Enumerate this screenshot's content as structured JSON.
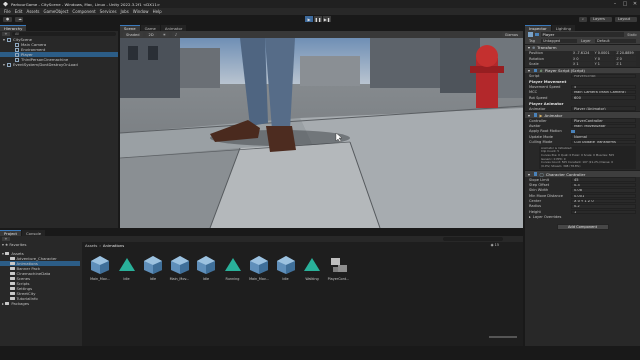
{
  "window": {
    "title": "ParkourGame - CityScene - Windows, Mac, Linux - Unity 2022.3.2f1 <DX11>",
    "controls": [
      "–",
      "□",
      "✕"
    ]
  },
  "menu": [
    "File",
    "Edit",
    "Assets",
    "GameObject",
    "Component",
    "Services",
    "Jobs",
    "Window",
    "Help"
  ],
  "toolbar": {
    "account": "●",
    "layers": "Layers",
    "layout": "Layout",
    "play_buttons": [
      "▶",
      "❚❚",
      "▶❚"
    ]
  },
  "hierarchy": {
    "tab": "Hierarchy",
    "search_placeholder": "All",
    "rows": [
      {
        "label": "CityScene",
        "indent": 0,
        "selected": false
      },
      {
        "label": "Main Camera",
        "indent": 1,
        "selected": false
      },
      {
        "label": "Environment",
        "indent": 1,
        "selected": false
      },
      {
        "label": "Player",
        "indent": 1,
        "selected": true
      },
      {
        "label": "ThirdPersonCinemachine",
        "indent": 1,
        "selected": false
      },
      {
        "label": "EventSystem/DontDestroyOnLoad",
        "indent": 0,
        "selected": false
      }
    ]
  },
  "center_tabs": [
    "Scene",
    "Game",
    "Animator"
  ],
  "scene_toolbar": {
    "shading": "Shaded",
    "mode": "2D",
    "gizmos": "Gizmos"
  },
  "project": {
    "tabs": [
      "Project",
      "Console"
    ],
    "breadcrumb": [
      "Assets",
      "Animations"
    ],
    "favorites_label": "Favorites",
    "assets_label": "Assets",
    "packages_label": "Packages",
    "folders": [
      "Adventure_Character",
      "Animations",
      "Banner Pack",
      "CinemachineData",
      "Scenes",
      "Scripts",
      "Settings",
      "StreetCity",
      "TutorialInfo"
    ],
    "items": [
      {
        "name": "Main_Mov...",
        "kind": "model"
      },
      {
        "name": "Idle",
        "kind": "clip"
      },
      {
        "name": "Idle",
        "kind": "model"
      },
      {
        "name": "Main_Mov...",
        "kind": "model"
      },
      {
        "name": "Idle",
        "kind": "model"
      },
      {
        "name": "Running",
        "kind": "clip"
      },
      {
        "name": "Main_Mov...",
        "kind": "model"
      },
      {
        "name": "Idle",
        "kind": "model"
      },
      {
        "name": "Walking",
        "kind": "clip"
      },
      {
        "name": "PlayerCont...",
        "kind": "controller"
      }
    ],
    "item_count": "15"
  },
  "inspector": {
    "tabs": [
      "Inspector",
      "Lighting"
    ],
    "object_name": "Player",
    "static_label": "Static",
    "tag_label": "Tag",
    "tag_value": "Untagged",
    "layer_label": "Layer",
    "layer_value": "Default",
    "transform": {
      "title": "Transform",
      "position_label": "Position",
      "position": [
        "-7.6124",
        "0.0001",
        "20.8859"
      ],
      "rotation_label": "Rotation",
      "rotation": [
        "0",
        "0",
        "0"
      ],
      "scale_label": "Scale",
      "scale": [
        "1",
        "1",
        "1"
      ]
    },
    "player_script": {
      "title": "Player Script (Script)",
      "script_label": "Script",
      "script_value": "PlayerScript",
      "movement_title": "Player Movement",
      "movement_speed_label": "Movement Speed",
      "movement_speed": "5",
      "mcc_label": "MCC",
      "mcc_value": "Main Camera (Main Camera)",
      "rot_speed_label": "Rot Speed",
      "rot_speed": "600",
      "anim_title": "Player Animator",
      "animator_label": "Animator",
      "animator_value": "Player (Animator)"
    },
    "animator": {
      "title": "Animator",
      "controller_label": "Controller",
      "controller_value": "PlayerController",
      "avatar_label": "Avatar",
      "avatar_value": "Main_MoveAvatar",
      "root_motion_label": "Apply Root Motion",
      "update_mode_label": "Update Mode",
      "update_mode_value": "Normal",
      "culling_mode_label": "Culling Mode",
      "culling_mode_value": "Cull Update Transforms",
      "info_lines": [
        "Animator is Initialized",
        "Clip Count: 5",
        "Curves Pos: 0 Quat: 0 Euler: 0 Scale: 0 Muscles: 505",
        "Generic: 0 PPtr: 0",
        "Curves Count: 505 Constant: 107 (21.2%) Dense: 0",
        "(0.0%) Stream: 398 (78.8%)"
      ]
    },
    "character_controller": {
      "title": "Character Controller",
      "rows": [
        {
          "label": "Slope Limit",
          "value": "45"
        },
        {
          "label": "Step Offset",
          "value": "0.3"
        },
        {
          "label": "Skin Width",
          "value": "0.08"
        },
        {
          "label": "Min Move Distance",
          "value": "0.001"
        },
        {
          "label": "Center",
          "value": "X 0   Y 1   Z 0"
        },
        {
          "label": "Radius",
          "value": "0.2"
        },
        {
          "label": "Height",
          "value": "1"
        }
      ],
      "layer_overrides": "Layer Overrides"
    },
    "add_component": "Add Component"
  },
  "colors": {
    "accent": "#3a79bb",
    "selection": "#2c5d87",
    "panel": "#282828",
    "background": "#191919"
  }
}
